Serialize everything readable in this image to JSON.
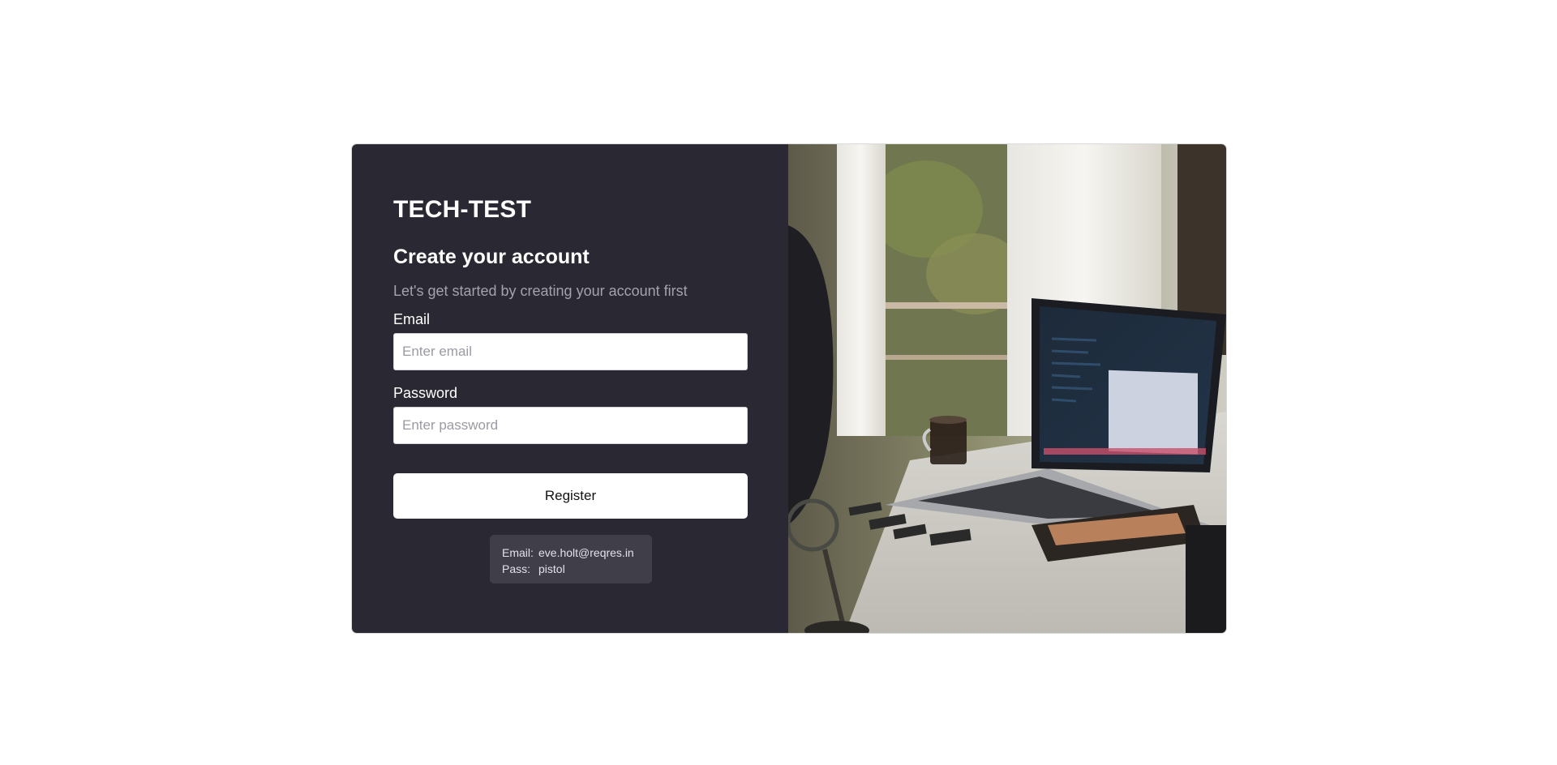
{
  "brand": "TECH-TEST",
  "form": {
    "heading": "Create your account",
    "subtitle": "Let's get started by creating your account first",
    "email_label": "Email",
    "email_placeholder": "Enter email",
    "email_value": "",
    "password_label": "Password",
    "password_placeholder": "Enter password",
    "password_value": "",
    "submit_label": "Register"
  },
  "hint": {
    "email_key": "Email:",
    "email_value": "eve.holt@reqres.in",
    "pass_key": "Pass:",
    "pass_value": "pistol"
  },
  "colors": {
    "panel_bg": "#292833",
    "hint_bg": "#3f3e49",
    "page_bg": "#ffffff"
  },
  "image": {
    "icon": "laptop-desk-photo"
  }
}
